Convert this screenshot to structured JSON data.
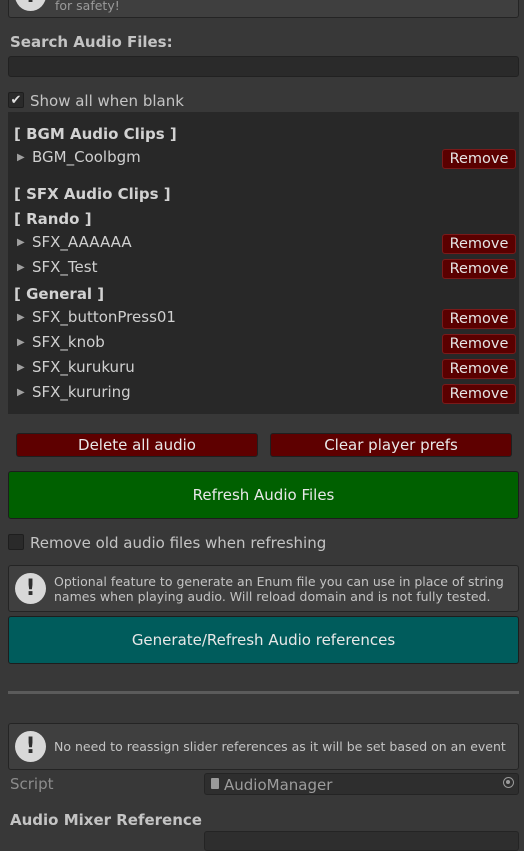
{
  "top_help": {
    "text_fragment": "for safety!",
    "icon": "info-icon"
  },
  "search": {
    "label": "Search Audio Files:",
    "value": "",
    "placeholder": ""
  },
  "show_all": {
    "label": "Show all when blank",
    "checked": true
  },
  "clip_list": {
    "bgm_header": "[ BGM Audio Clips ]",
    "bgm_items": [
      "BGM_Coolbgm"
    ],
    "sfx_header": "[ SFX Audio Clips ]",
    "rando_header": "[ Rando ]",
    "rando_items": [
      "SFX_AAAAAA",
      "SFX_Test"
    ],
    "general_header": "[ General ]",
    "general_items": [
      "SFX_buttonPress01",
      "SFX_knob",
      "SFX_kurukuru",
      "SFX_kururing"
    ],
    "remove_label": "Remove"
  },
  "actions": {
    "delete_all": "Delete all audio",
    "clear_prefs": "Clear player prefs",
    "refresh": "Refresh Audio Files"
  },
  "remove_old": {
    "label": "Remove old audio files when refreshing",
    "checked": false
  },
  "enum_help": {
    "text": "Optional feature to generate an Enum file you can use in place of string names when playing audio. Will reload domain and is not fully tested.",
    "icon": "info-icon"
  },
  "generate_button": "Generate/Refresh Audio references",
  "slider_help": {
    "text": "No need to reassign slider references as it will be set based on an event",
    "icon": "info-icon"
  },
  "script_field": {
    "label": "Script",
    "value": "AudioManager"
  },
  "mixer_section": {
    "label": "Audio Mixer Reference"
  },
  "colors": {
    "background": "#383838",
    "remove_button": "#5a0000",
    "refresh_button": "#006000",
    "generate_button": "#005c5c"
  }
}
